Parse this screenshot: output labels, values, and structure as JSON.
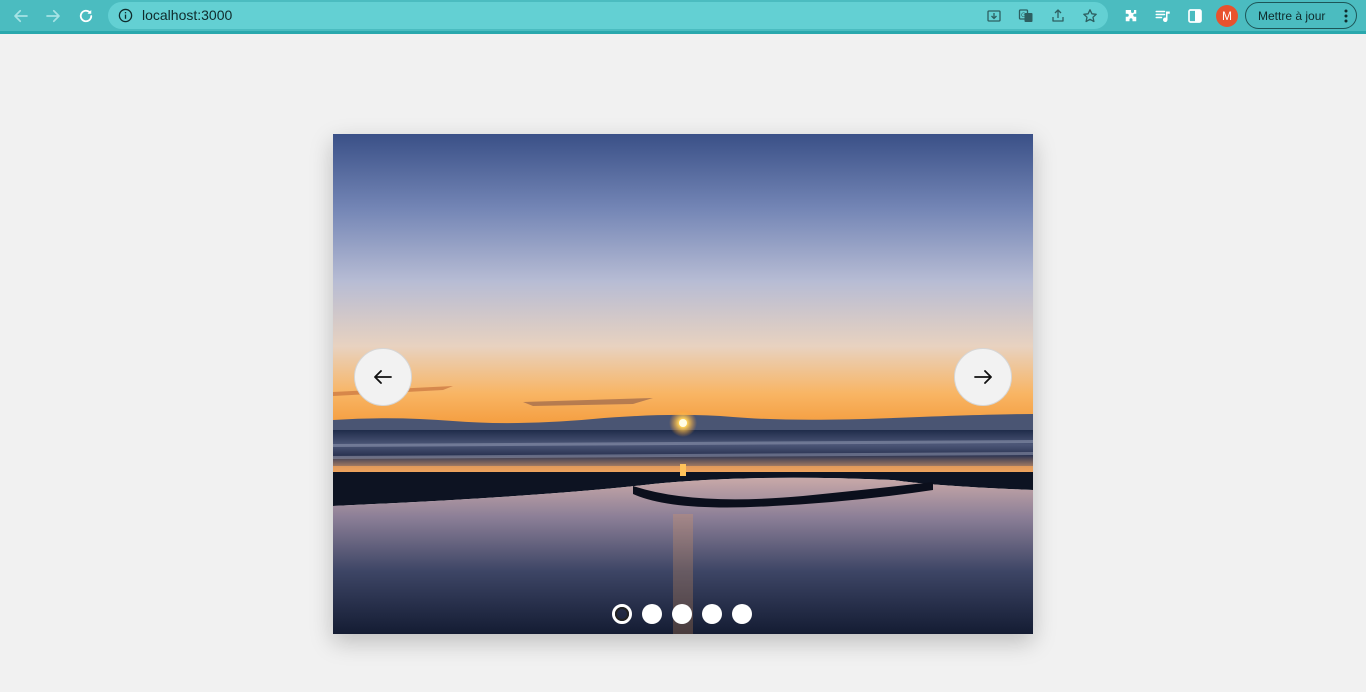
{
  "browser": {
    "url": "localhost:3000",
    "avatar_initial": "M",
    "update_label": "Mettre à jour",
    "accent_color": "#4bbcc0"
  },
  "slider": {
    "slide_count": 5,
    "active_index": 0,
    "prev_icon": "arrow-left-icon",
    "next_icon": "arrow-right-icon"
  }
}
